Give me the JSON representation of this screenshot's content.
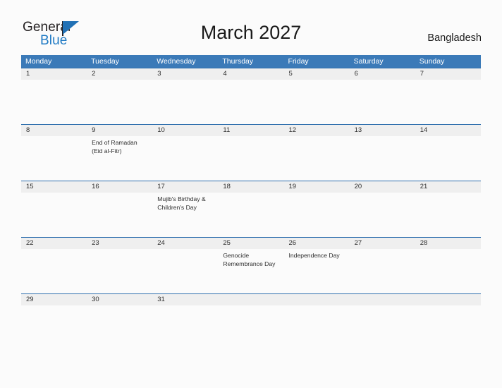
{
  "brand": {
    "name_top": "General",
    "name_bottom": "Blue",
    "flag_icon": "flag-triangle-icon",
    "color_primary": "#2171b5",
    "color_text": "#231f20"
  },
  "header": {
    "title": "March 2027",
    "country": "Bangladesh"
  },
  "calendar": {
    "accent_color": "#3b7ab8",
    "daynum_band_color": "#efefef",
    "weekdays": [
      "Monday",
      "Tuesday",
      "Wednesday",
      "Thursday",
      "Friday",
      "Saturday",
      "Sunday"
    ],
    "weeks": [
      {
        "days": [
          {
            "num": "1",
            "event": ""
          },
          {
            "num": "2",
            "event": ""
          },
          {
            "num": "3",
            "event": ""
          },
          {
            "num": "4",
            "event": ""
          },
          {
            "num": "5",
            "event": ""
          },
          {
            "num": "6",
            "event": ""
          },
          {
            "num": "7",
            "event": ""
          }
        ]
      },
      {
        "days": [
          {
            "num": "8",
            "event": ""
          },
          {
            "num": "9",
            "event": "End of Ramadan\n(Eid al-Fitr)"
          },
          {
            "num": "10",
            "event": ""
          },
          {
            "num": "11",
            "event": ""
          },
          {
            "num": "12",
            "event": ""
          },
          {
            "num": "13",
            "event": ""
          },
          {
            "num": "14",
            "event": ""
          }
        ]
      },
      {
        "days": [
          {
            "num": "15",
            "event": ""
          },
          {
            "num": "16",
            "event": ""
          },
          {
            "num": "17",
            "event": "Mujib's Birthday &\nChildren's Day"
          },
          {
            "num": "18",
            "event": ""
          },
          {
            "num": "19",
            "event": ""
          },
          {
            "num": "20",
            "event": ""
          },
          {
            "num": "21",
            "event": ""
          }
        ]
      },
      {
        "days": [
          {
            "num": "22",
            "event": ""
          },
          {
            "num": "23",
            "event": ""
          },
          {
            "num": "24",
            "event": ""
          },
          {
            "num": "25",
            "event": "Genocide\nRemembrance Day"
          },
          {
            "num": "26",
            "event": "Independence Day"
          },
          {
            "num": "27",
            "event": ""
          },
          {
            "num": "28",
            "event": ""
          }
        ]
      },
      {
        "days": [
          {
            "num": "29",
            "event": ""
          },
          {
            "num": "30",
            "event": ""
          },
          {
            "num": "31",
            "event": ""
          },
          {
            "num": "",
            "event": ""
          },
          {
            "num": "",
            "event": ""
          },
          {
            "num": "",
            "event": ""
          },
          {
            "num": "",
            "event": ""
          }
        ]
      }
    ]
  }
}
